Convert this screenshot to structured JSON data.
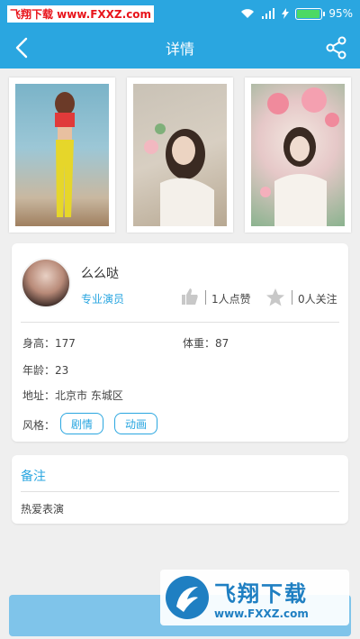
{
  "status_bar": {
    "watermark": "飞翔下载 www.FXXZ.com",
    "battery": "95%",
    "battery_level": 0.95
  },
  "navbar": {
    "title": "详情"
  },
  "photos": [
    {
      "name": "photo-1"
    },
    {
      "name": "photo-2"
    },
    {
      "name": "photo-3"
    }
  ],
  "profile": {
    "name": "么么哒",
    "role": "专业演员",
    "likes": "1人点赞",
    "follows": "0人关注",
    "height": "身高：177",
    "weight": "体重：87",
    "age": "年龄：23",
    "address": "地址：北京市 东城区",
    "style_label": "风格：",
    "style_tags": [
      "剧情",
      "动画"
    ]
  },
  "remark": {
    "title": "备注",
    "text": "热爱表演"
  },
  "watermark_bottom": {
    "big": "飞翔下载",
    "url": "www.FXXZ.com"
  },
  "colors": {
    "primary": "#2aa6e0",
    "button": "#7fc4ea",
    "background": "#efefef"
  }
}
